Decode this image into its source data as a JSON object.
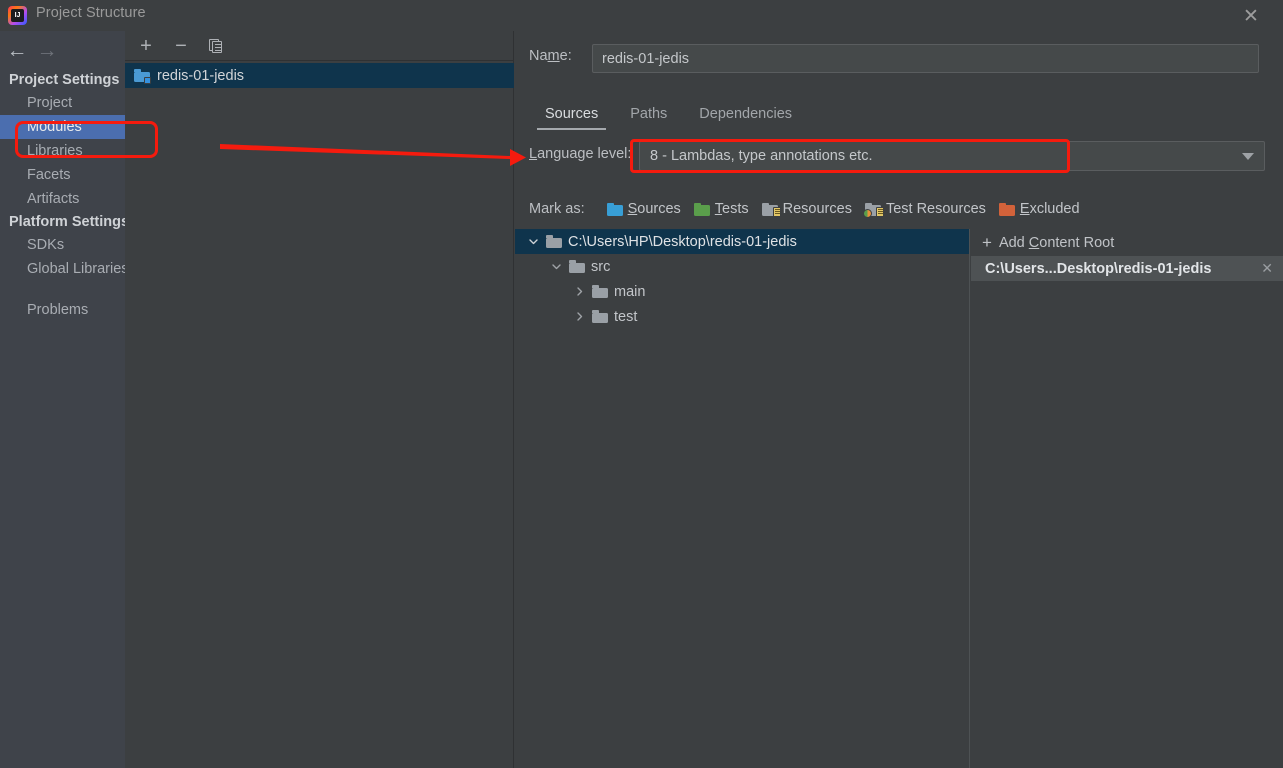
{
  "window": {
    "title": "Project Structure",
    "logo_text": "IJ",
    "close_icon": "close-icon"
  },
  "sidebar": {
    "back_icon": "arrow-left-icon",
    "forward_icon": "arrow-right-icon",
    "groups": [
      {
        "label": "Project Settings",
        "items": [
          {
            "label": "Project",
            "selected": false
          },
          {
            "label": "Modules",
            "selected": true
          },
          {
            "label": "Libraries",
            "selected": false
          },
          {
            "label": "Facets",
            "selected": false
          },
          {
            "label": "Artifacts",
            "selected": false
          }
        ]
      },
      {
        "label": "Platform Settings",
        "items": [
          {
            "label": "SDKs",
            "selected": false
          },
          {
            "label": "Global Libraries",
            "selected": false
          }
        ]
      }
    ],
    "problems": "Problems"
  },
  "modules_panel": {
    "toolbar": {
      "add_icon": "plus-icon",
      "remove_icon": "minus-icon",
      "copy_icon": "copy-icon"
    },
    "items": [
      {
        "label": "redis-01-jedis",
        "icon": "module-folder-icon",
        "selected": true
      }
    ]
  },
  "detail": {
    "name_label_pre": "Na",
    "name_label_mnemonic": "m",
    "name_label_post": "e:",
    "name_value": "redis-01-jedis",
    "name_placeholder": "",
    "tabs": [
      {
        "label": "Sources",
        "active": true
      },
      {
        "label": "Paths",
        "active": false
      },
      {
        "label": "Dependencies",
        "active": false
      }
    ],
    "language_level": {
      "label_mnemonic": "L",
      "label_post": "anguage level:",
      "value": "8 - Lambdas, type annotations etc.",
      "caret_icon": "chevron-down-icon"
    },
    "mark_as": {
      "label": "Mark as:",
      "options": [
        {
          "mnemonic": "S",
          "rest": "ources",
          "icon": "folder-sources-icon",
          "color": "#389fd6"
        },
        {
          "mnemonic": "T",
          "rest": "ests",
          "icon": "folder-tests-icon",
          "color": "#5a9e4b"
        },
        {
          "mnemonic": "",
          "rest": "Resources",
          "icon": "folder-resources-icon",
          "color": "#9aa0a6"
        },
        {
          "mnemonic": "",
          "rest": "Test Resources",
          "icon": "folder-test-resources-icon",
          "color": "#9aa0a6"
        },
        {
          "mnemonic": "E",
          "rest": "xcluded",
          "icon": "folder-excluded-icon",
          "color": "#d2623a"
        }
      ]
    },
    "tree": [
      {
        "label": "C:\\Users\\HP\\Desktop\\redis-01-jedis",
        "depth": 0,
        "state": "expanded",
        "selected": true
      },
      {
        "label": "src",
        "depth": 1,
        "state": "expanded",
        "selected": false
      },
      {
        "label": "main",
        "depth": 2,
        "state": "collapsed",
        "selected": false
      },
      {
        "label": "test",
        "depth": 2,
        "state": "collapsed",
        "selected": false
      }
    ],
    "content_roots": {
      "add_label_pre": "Add ",
      "add_label_mnemonic": "C",
      "add_label_post": "ontent Root",
      "add_icon": "plus-icon",
      "items": [
        {
          "label": "C:\\Users...Desktop\\redis-01-jedis",
          "close_icon": "close-icon",
          "selected": true
        }
      ]
    }
  },
  "annotations": {
    "highlight_color": "#f51b0e",
    "boxes": [
      "modules-nav-item",
      "language-level-combo"
    ],
    "arrow": "points-to-language-level"
  }
}
